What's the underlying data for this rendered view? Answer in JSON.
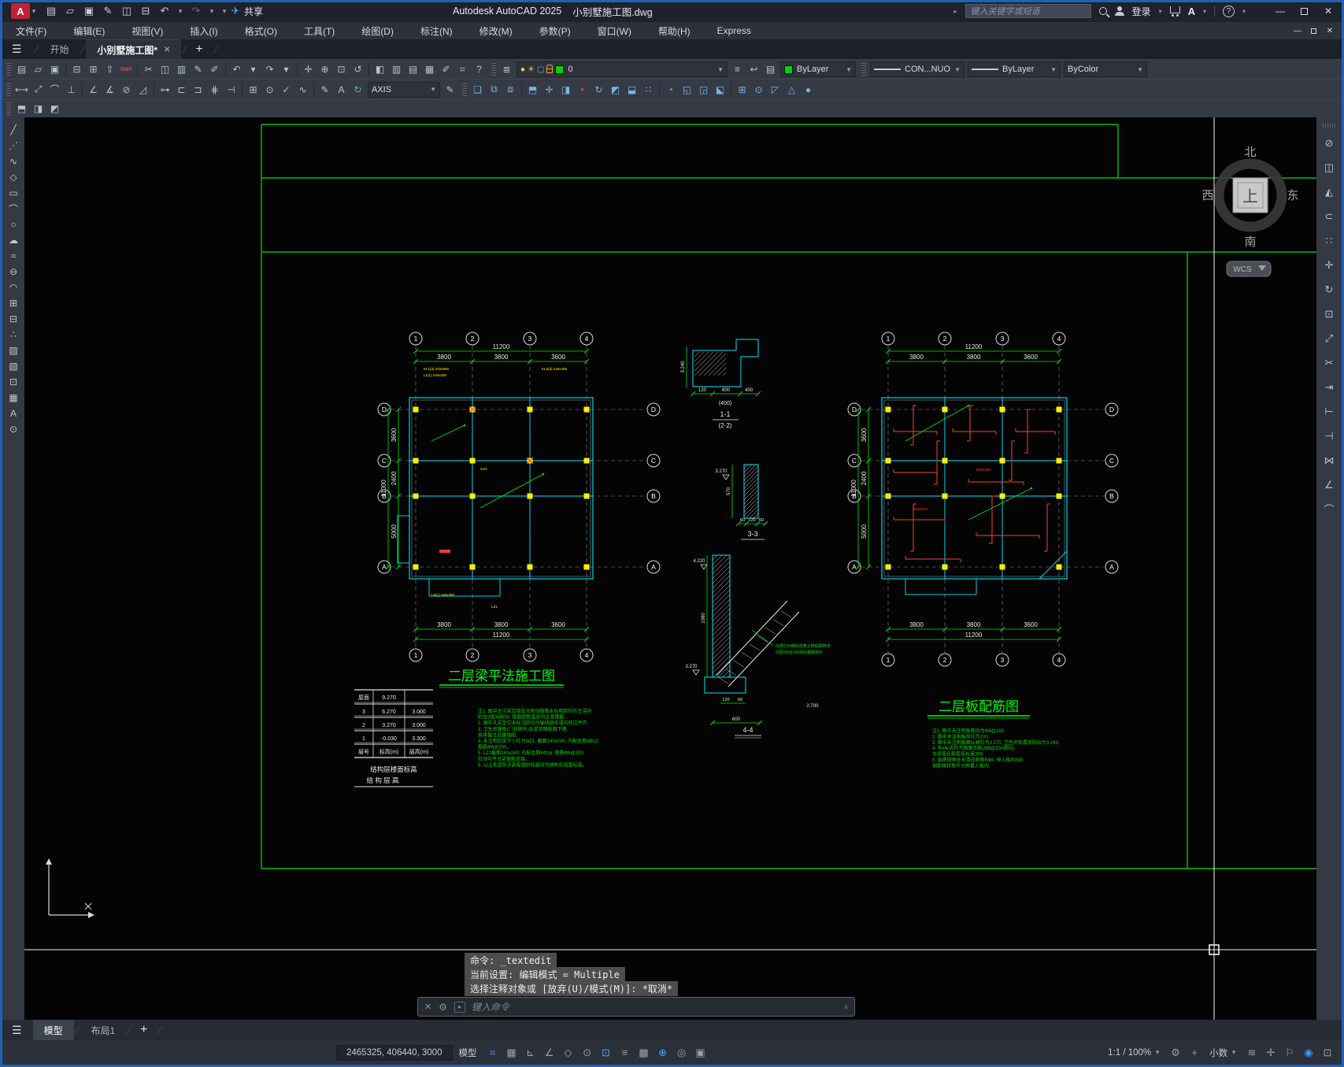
{
  "titlebar": {
    "app_logo": "A",
    "title": "Autodesk AutoCAD 2025",
    "doc_name": "小别墅施工图.dwg",
    "share_label": "共享",
    "search_placeholder": "键入关键字或短语",
    "sign_in_label": "登录",
    "qat_icons": [
      [
        "qnew",
        "▤"
      ],
      [
        "open",
        "▱"
      ],
      [
        "save",
        "▣"
      ],
      [
        "save-as",
        "✎"
      ],
      [
        "save-to-mobile",
        "◫"
      ],
      [
        "plot",
        "⊟"
      ],
      [
        "undo",
        "↶"
      ],
      [
        "undo-menu",
        "▾"
      ],
      [
        "redo",
        "↷"
      ],
      [
        "redo-menu",
        "▾"
      ],
      [
        "customize-qat",
        "▾"
      ]
    ]
  },
  "menubar": {
    "items": [
      "文件(F)",
      "编辑(E)",
      "视图(V)",
      "插入(I)",
      "格式(O)",
      "工具(T)",
      "绘图(D)",
      "标注(N)",
      "修改(M)",
      "参数(P)",
      "窗口(W)",
      "帮助(H)",
      "Express"
    ]
  },
  "file_tabs": {
    "start": "开始",
    "doc": "小别墅施工图*",
    "close_glyph": "✕",
    "new_glyph": "+"
  },
  "toolbars": {
    "row1": [
      [
        "qnew",
        "▤"
      ],
      [
        "open",
        "▱"
      ],
      [
        "save",
        "▣"
      ],
      [
        "|",
        ""
      ],
      [
        "plot",
        "⊟"
      ],
      [
        "plot-preview",
        "⊞"
      ],
      [
        "publish",
        "⇧"
      ],
      [
        "dwf",
        "DWF",
        "red"
      ],
      [
        "|",
        ""
      ],
      [
        "cut",
        "✂"
      ],
      [
        "copy-clip",
        "◫"
      ],
      [
        "paste",
        "▥"
      ],
      [
        "match-properties",
        "✎"
      ],
      [
        "markup-import",
        "✐"
      ],
      [
        "|",
        ""
      ],
      [
        "undo",
        "↶"
      ],
      [
        "undo-menu",
        "▾"
      ],
      [
        "redo",
        "↷"
      ],
      [
        "redo-menu",
        "▾"
      ],
      [
        "|",
        ""
      ],
      [
        "pan",
        "✛"
      ],
      [
        "zoom-realtime",
        "⊕"
      ],
      [
        "zoom-window",
        "⊡"
      ],
      [
        "zoom-previous",
        "↺"
      ],
      [
        "|",
        ""
      ],
      [
        "properties-palette",
        "◧"
      ],
      [
        "design-center",
        "▥"
      ],
      [
        "tool-palettes",
        "▤"
      ],
      [
        "sheet-set-manager",
        "▦"
      ],
      [
        "markup",
        "✐"
      ],
      [
        "quick-calc",
        "⌗"
      ],
      [
        "help",
        "?"
      ]
    ],
    "layer_tools": [
      [
        "layer-properties-manager",
        "≣"
      ],
      [
        "make-object-layer-current",
        "≡"
      ],
      [
        "layer-previous",
        "↩"
      ],
      [
        "layer-states",
        "▤"
      ]
    ],
    "layer_value": "0",
    "color_value": "ByLayer",
    "linetype_value": "CON...NUOU",
    "lineweight_value": "ByLayer",
    "plotstyle_value": "ByColor",
    "dimstyle_value": "AXIS",
    "row2_dim": [
      [
        "linear-dimension",
        "⟷"
      ],
      [
        "aligned-dimension",
        "⤢"
      ],
      [
        "arc-length-dimension",
        "⌒"
      ],
      [
        "ordinate-dimension",
        "⊥"
      ],
      [
        "|",
        ""
      ],
      [
        "angular-dimension",
        "∠"
      ],
      [
        "angular-3pt",
        "∡"
      ],
      [
        "diameter-dimension",
        "⊘"
      ],
      [
        "radius-dimension",
        "◿"
      ],
      [
        "|",
        ""
      ],
      [
        "quick-dimension",
        "⊶"
      ],
      [
        "baseline-dimension",
        "⊏"
      ],
      [
        "continue-dimension",
        "⊐"
      ],
      [
        "dimension-spacing",
        "⋕"
      ],
      [
        "dimension-break",
        "⊣"
      ],
      [
        "|",
        ""
      ],
      [
        "tolerance",
        "⊞"
      ],
      [
        "center-mark",
        "⊙"
      ],
      [
        "dimension-inspect",
        "✓"
      ],
      [
        "dimension-jog",
        "∿"
      ],
      [
        "|",
        ""
      ],
      [
        "dimension-edit",
        "✎"
      ],
      [
        "dimension-text-edit",
        "A"
      ],
      [
        "dimension-update",
        "↻",
        "green"
      ]
    ],
    "row2_modeling": [
      [
        "union",
        "❏"
      ],
      [
        "subtract",
        "⧉"
      ],
      [
        "intersect",
        "⧈"
      ],
      [
        "|",
        ""
      ],
      [
        "extrude",
        "⬒"
      ],
      [
        "move-3d",
        "✛"
      ],
      [
        "presspull",
        "◨"
      ],
      [
        "erase-solid",
        "✕"
      ],
      [
        "rotate-3d",
        "↻"
      ],
      [
        "sweep",
        "◩"
      ],
      [
        "loft",
        "⬓"
      ],
      [
        "array-3d",
        "∷"
      ],
      [
        "|",
        ""
      ],
      [
        "fillet-edge",
        "◔"
      ],
      [
        "chamfer-edge",
        "◱"
      ],
      [
        "shell",
        "◲"
      ],
      [
        "slice",
        "⬕"
      ],
      [
        "|",
        ""
      ],
      [
        "box",
        "⊞"
      ],
      [
        "cylinder",
        "⊙"
      ],
      [
        "wedge",
        "◸"
      ],
      [
        "cone",
        "△"
      ],
      [
        "sphere",
        "●"
      ]
    ],
    "row3": [
      [
        "visual-styles",
        "⬒"
      ],
      [
        "render-preset",
        "◨"
      ],
      [
        "materials-browser",
        "◩"
      ]
    ]
  },
  "left_toolbar": [
    [
      "line",
      "╱"
    ],
    [
      "construction-line",
      "⋰"
    ],
    [
      "polyline",
      "∿"
    ],
    [
      "polygon",
      "◇"
    ],
    [
      "rectangle",
      "▭"
    ],
    [
      "arc",
      "⌒"
    ],
    [
      "circle",
      "○"
    ],
    [
      "revision-cloud",
      "☁"
    ],
    [
      "spline",
      "≈"
    ],
    [
      "ellipse",
      "⊖"
    ],
    [
      "ellipse-arc",
      "◠"
    ],
    [
      "insert-block",
      "⊞"
    ],
    [
      "make-block",
      "⊟"
    ],
    [
      "point",
      "∴"
    ],
    [
      "hatch",
      "▨"
    ],
    [
      "gradient",
      "▧"
    ],
    [
      "region",
      "⊡"
    ],
    [
      "table",
      "▦"
    ],
    [
      "multiline-text",
      "A"
    ],
    [
      "add-selected",
      "⊙"
    ]
  ],
  "right_toolbar": [
    [
      "erase",
      "⊘"
    ],
    [
      "copy",
      "◫"
    ],
    [
      "mirror",
      "◭"
    ],
    [
      "offset",
      "⊂"
    ],
    [
      "array",
      "∷"
    ],
    [
      "move",
      "✛"
    ],
    [
      "rotate",
      "↻"
    ],
    [
      "scale",
      "⊡"
    ],
    [
      "stretch",
      "⤢"
    ],
    [
      "trim",
      "✂"
    ],
    [
      "extend",
      "⇥"
    ],
    [
      "break-at-point",
      "⊢"
    ],
    [
      "break",
      "⊣"
    ],
    [
      "join",
      "⋈"
    ],
    [
      "chamfer",
      "∠"
    ],
    [
      "fillet",
      "⌒"
    ]
  ],
  "compass": {
    "north": "北",
    "south": "南",
    "east": "东",
    "west": "西",
    "center": "上",
    "ucs_label": "WCS"
  },
  "drawing": {
    "left_plan": {
      "title": "二层梁平法施工图",
      "col_bubbles": [
        "1",
        "2",
        "3",
        "4"
      ],
      "row_bubbles": [
        "D",
        "C",
        "B",
        "A"
      ],
      "top_span_dims": [
        "3800",
        "3800",
        "3600"
      ],
      "top_total_dim": "11200",
      "bottom_span_dims": [
        "3800",
        "3800",
        "3600"
      ],
      "bottom_total_dim": "11200",
      "side_span_dims": [
        "3600",
        "2400",
        "5000"
      ],
      "side_total_dim": "11000",
      "beam_labels": [
        "KL1(3) 240x500",
        "L1(1) 240x300",
        "KL2(3) 240x400",
        "L5(1) 240x300",
        "LZ1",
        "GZ1"
      ]
    },
    "right_plan": {
      "title": "二层板配筋图",
      "col_bubbles": [
        "1",
        "2",
        "3",
        "4"
      ],
      "row_bubbles": [
        "D",
        "C",
        "B",
        "A"
      ],
      "top_span_dims": [
        "3800",
        "3800",
        "3600"
      ],
      "top_total_dim": "11200",
      "bottom_span_dims": [
        "3800",
        "3800",
        "3600"
      ],
      "bottom_total_dim": "11200",
      "side_span_dims": [
        "3600",
        "2400",
        "5000"
      ],
      "side_total_dim": "11000",
      "rebar_labels": [
        "Φ8@180",
        "Φ8@200"
      ]
    },
    "details": {
      "d1": {
        "label": "1-1",
        "sub": "(2-2)",
        "dim_top": "3.240",
        "dims_bottom": [
          "120",
          "600",
          "400"
        ],
        "dim_paren": "(400)"
      },
      "d2": {
        "label": "3-3",
        "dim_left": "3.270",
        "dim_side": "570",
        "dims_bottom": [
          "60",
          "120",
          "60"
        ]
      },
      "d3": {
        "label": "4-4",
        "dim_top": "4.220",
        "dim_mid": "3.270",
        "dim_side": "1080",
        "dim_right": "2.700",
        "dims_bottom": [
          "120",
          "60"
        ],
        "dim_bottom2": "600",
        "note_lines": [
          "60厚C25细石混凝土随捣随抹光",
          "内配Φ6@150双向钢筋网片"
        ]
      }
    },
    "elevation_table": {
      "rows": [
        [
          "屋面",
          "9.270",
          ""
        ],
        [
          "3",
          "6.270",
          "3.000"
        ],
        [
          "2",
          "3.270",
          "3.000"
        ],
        [
          "1",
          "-0.030",
          "3.300"
        ],
        [
          "层号",
          "标高(m)",
          "层高(m)"
        ]
      ],
      "caption1": "结构层楼面标高",
      "caption2": "结 构 层 高"
    },
    "left_notes": [
      "注1. 图中主次梁交接处凡附加箍筋未标明的均在主梁内",
      "        附加3根间距50, 箍筋肢数直径同主梁箍筋;",
      "2. 图中凡梁定位未标注的均为轴线居中或与柱边平齐;",
      "3. 卫生间降板(门洞除外)处梁顶随板面下降,",
      "        具体做法见建施图;",
      "4. 未注明的梁下小柱为GZ1, 截面240x240, 内配主筋4Φ12,",
      "        箍筋Φ6@200。",
      "5. LZ1截面240x240, 内配主筋4Φ16, 箍筋Φ6@200,",
      "        柱顶与平台梁钢筋连接。",
      "6. 以上各层所示高程线的标高均为结构完成面标高。"
    ],
    "right_notes": [
      "注1. 图中未注明板筋均为Φ8@180.",
      "2. 图中未注明板厚均为100.",
      "3. 图中未注明板面标高均为3.270, 卫生间及露天阳台为3.240.",
      "4. 有♯标志的为板面负筋(Φ6@200双向),",
      "        与梁面负筋搭接长度300.",
      "5. 挑檐转角处采用放射筋5Φ8, 伸入板内500,",
      "        钢筋按转角平分布置入板内."
    ],
    "colors": {
      "green": "#00e400",
      "cyan": "#00e5ff",
      "yellow": "#ffee00",
      "red": "#ff3b30",
      "white": "#e8e8e8"
    }
  },
  "command": {
    "line1": "命令: _textedit",
    "line2": "当前设置: 编辑模式 = Multiple",
    "line3": "选择注释对象或 [放弃(U)/模式(M)]: *取消*",
    "placeholder": "键入命令"
  },
  "layout_tabs": {
    "model": "模型",
    "layout1": "布局1",
    "new_glyph": "+"
  },
  "statusbar": {
    "coords": "2465325, 406440, 3000",
    "model_label": "模型",
    "toggles": [
      [
        "grid",
        "⌗",
        "on"
      ],
      [
        "snap-mode",
        "▦",
        ""
      ],
      [
        "ortho-mode",
        "⊾",
        ""
      ],
      [
        "polar-tracking",
        "∠",
        ""
      ],
      [
        "isometric-drafting",
        "◇",
        ""
      ],
      [
        "object-snap-tracking",
        "⊙",
        ""
      ],
      [
        "object-snap",
        "⊡",
        "on"
      ],
      [
        "lineweight-display",
        "≡",
        ""
      ],
      [
        "transparency",
        "▩",
        ""
      ],
      [
        "dynamic-input",
        "⊕",
        "on"
      ],
      [
        "selection-cycling",
        "◎",
        ""
      ],
      [
        "dynamic-ucs",
        "▣",
        ""
      ]
    ],
    "annotation_scale": "1:1 / 100%",
    "units": "小数",
    "right_icons": [
      [
        "workspace-switching",
        "⚙"
      ],
      [
        "annotation-add",
        "+"
      ],
      [
        "selection-filter",
        "≋"
      ],
      [
        "gizmo",
        "✛"
      ],
      [
        "annotation-monitor",
        "⚐"
      ],
      [
        "status-tray",
        "◉",
        "blue"
      ],
      [
        "clean-screen",
        "⊡"
      ]
    ]
  }
}
